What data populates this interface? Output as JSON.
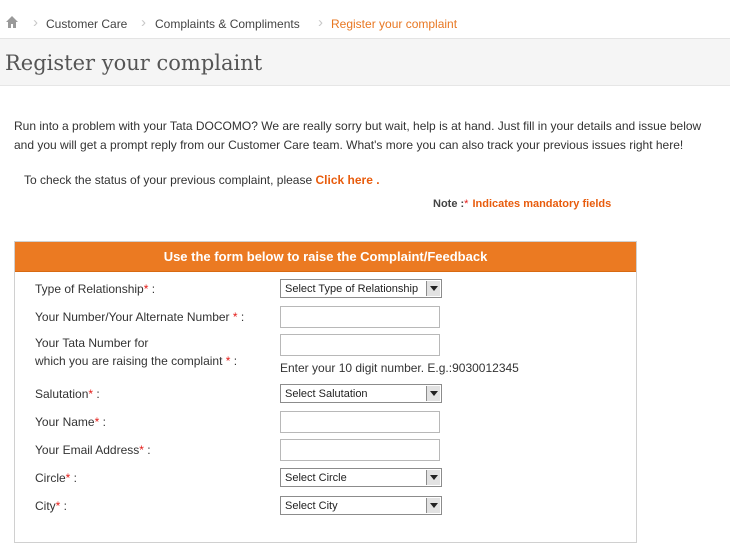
{
  "breadcrumb": {
    "items": [
      "Customer Care",
      "Complaints & Compliments",
      "Register your complaint"
    ]
  },
  "page": {
    "title": "Register your complaint",
    "intro": "Run into a problem with your Tata DOCOMO? We are really sorry but wait, help is at hand. Just fill in your details and issue below and you will get a prompt reply from our Customer Care team. What's more you can also track your previous issues right here!",
    "status_text": "To check the status of your previous complaint, please",
    "status_link": "Click here",
    "status_period": ".",
    "note_label": "Note :",
    "note_star": "*",
    "note_text": "Indicates mandatory fields"
  },
  "form": {
    "header": "Use the form below to raise the Complaint/Feedback",
    "relationship": {
      "label": "Type of Relationship",
      "value": "Select Type of Relationship"
    },
    "number": {
      "label": "Your Number/Your Alternate Number"
    },
    "tata": {
      "label_line1": "Your Tata Number for",
      "label_line2": "which you are raising the complaint",
      "hint": "Enter your 10 digit number. E.g.:9030012345"
    },
    "salutation": {
      "label": "Salutation",
      "value": "Select Salutation"
    },
    "name": {
      "label": "Your Name"
    },
    "email": {
      "label": "Your Email Address"
    },
    "circle": {
      "label": "Circle",
      "value": "Select Circle"
    },
    "city": {
      "label": "City",
      "value": "Select City"
    },
    "star": "*",
    "colon": " :"
  },
  "colors": {
    "accent": "#eb7a22",
    "link": "#e85c0d",
    "required": "#e41b17"
  },
  "icons": {
    "home": "home-icon",
    "separator": "chevron-right-icon",
    "dropdown": "dropdown-arrow-icon"
  }
}
